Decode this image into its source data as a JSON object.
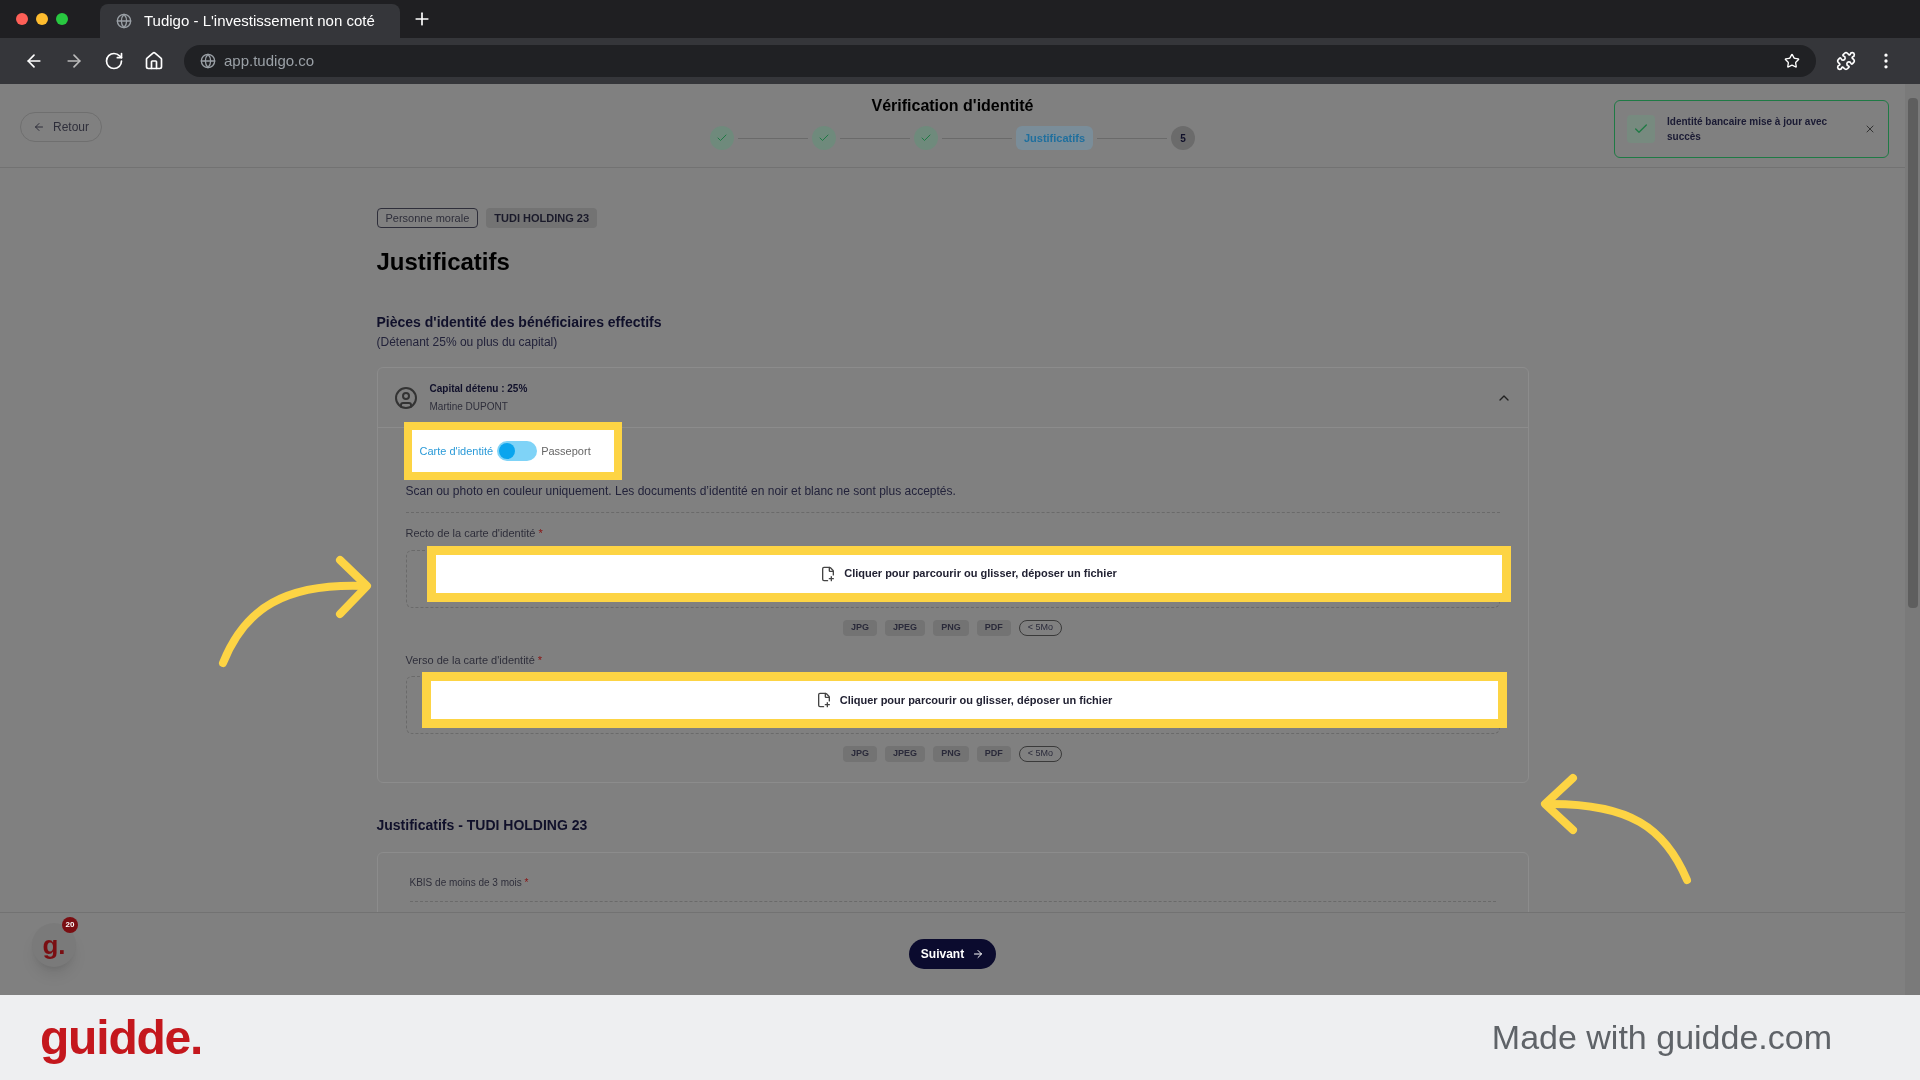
{
  "browser": {
    "tab_title": "Tudigo - L'investissement non coté",
    "url": "app.tudigo.co"
  },
  "header": {
    "back": "Retour",
    "title": "Vérification d'identité",
    "steps": [
      {
        "kind": "done"
      },
      {
        "kind": "done"
      },
      {
        "kind": "done"
      },
      {
        "kind": "current",
        "label": "Justificatifs"
      },
      {
        "kind": "pending",
        "label": "5"
      }
    ]
  },
  "toast": {
    "message": "Identité bancaire mise à jour avec succès"
  },
  "tags": [
    "Personne morale",
    "TUDI HOLDING 23"
  ],
  "heading": "Justificatifs",
  "section": {
    "title": "Pièces d'identité des bénéficiaires effectifs",
    "subtitle": "(Détenant 25% ou plus du capital)"
  },
  "beneficiary": {
    "capital": "Capital détenu : 25%",
    "name": "Martine DUPONT",
    "expanded": true,
    "toggle": {
      "left": "Carte d'identité",
      "right": "Passeport",
      "on": false
    },
    "notice": "Scan ou photo en couleur uniquement. Les documents d’identité en noir et blanc ne sont plus acceptés.",
    "uploads": [
      {
        "label": "Recto de la carte d'identité",
        "required": "*",
        "prompt": "Cliquer pour parcourir ou glisser, déposer un fichier",
        "formats": [
          "JPG",
          "JPEG",
          "PNG",
          "PDF"
        ],
        "limit": "< 5Mo"
      },
      {
        "label": "Verso de la carte d'identité",
        "required": "*",
        "prompt": "Cliquer pour parcourir ou glisser, déposer un fichier",
        "formats": [
          "JPG",
          "JPEG",
          "PNG",
          "PDF"
        ],
        "limit": "< 5Mo"
      }
    ]
  },
  "section2": {
    "title": "Justificatifs - TUDI HOLDING 23",
    "field_label": "KBIS de moins de 3 mois",
    "required": "*"
  },
  "footer_button": "Suivant",
  "assistant_badge": {
    "letter": "g.",
    "count": "20"
  },
  "branding_bar": {
    "logo": "guidde.",
    "tagline": "Made with guidde.com"
  }
}
